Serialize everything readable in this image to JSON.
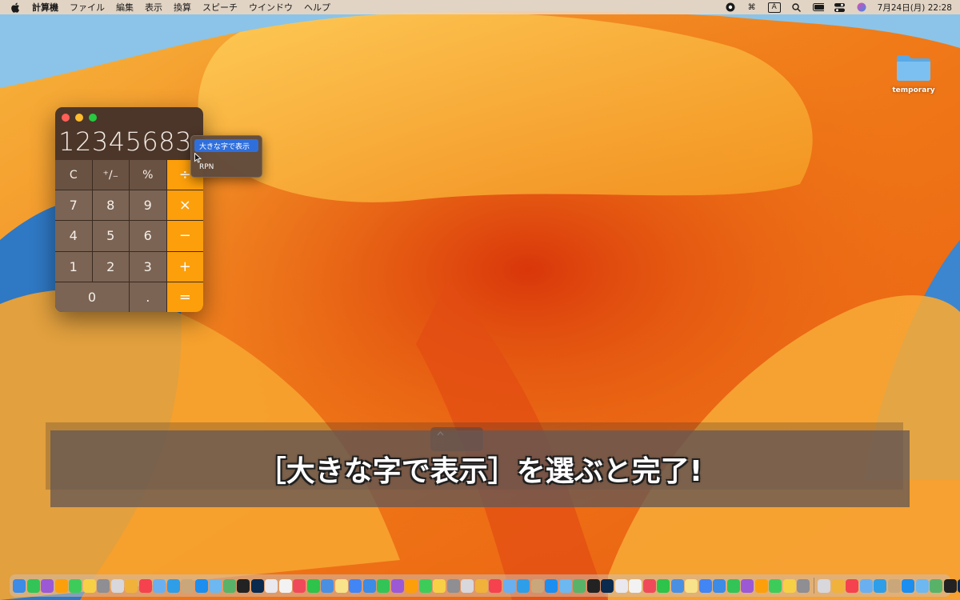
{
  "menubar": {
    "app_name": "計算機",
    "items": [
      "ファイル",
      "編集",
      "表示",
      "換算",
      "スピーチ",
      "ウインドウ",
      "ヘルプ"
    ],
    "datetime": "7月24日(月)  22:28",
    "input_indicator": "A"
  },
  "desktop": {
    "folder_label": "temporary"
  },
  "calculator": {
    "display": "12345683",
    "keys": {
      "clear": "C",
      "sign": "⁺∕₋",
      "percent": "%",
      "divide": "÷",
      "seven": "7",
      "eight": "8",
      "nine": "9",
      "multiply": "×",
      "four": "4",
      "five": "5",
      "six": "6",
      "minus": "−",
      "one": "1",
      "two": "2",
      "three": "3",
      "plus": "+",
      "zero": "0",
      "decimal": ".",
      "equals": "="
    }
  },
  "context_menu": {
    "items": [
      "大きな字で表示",
      "RPN"
    ],
    "highlighted": "大きな字で表示"
  },
  "caption": {
    "text": "［大きな字で表示］を選ぶと完了!"
  },
  "colors": {
    "calculator_body": "#4c3629",
    "operator_key": "#fd9f0a",
    "menu_highlight": "#2f6fdc",
    "wallpaper_orange": "#f08a1c"
  },
  "dock": {
    "icons": [
      "finder-icon",
      "launchpad-icon",
      "safari-icon",
      "messages-icon",
      "mail-icon",
      "maps-icon",
      "photos-icon",
      "facetime-icon",
      "calendar-icon",
      "contacts-icon",
      "reminders-icon",
      "notes-icon",
      "tv-icon",
      "music-icon",
      "podcasts-icon",
      "news-icon",
      "app-store-icon",
      "system-settings-icon",
      "chrome-icon",
      "photoshop-icon",
      "preview-icon",
      "calculator-icon",
      "line-icon",
      "folder-icon",
      "trash-icon"
    ]
  }
}
